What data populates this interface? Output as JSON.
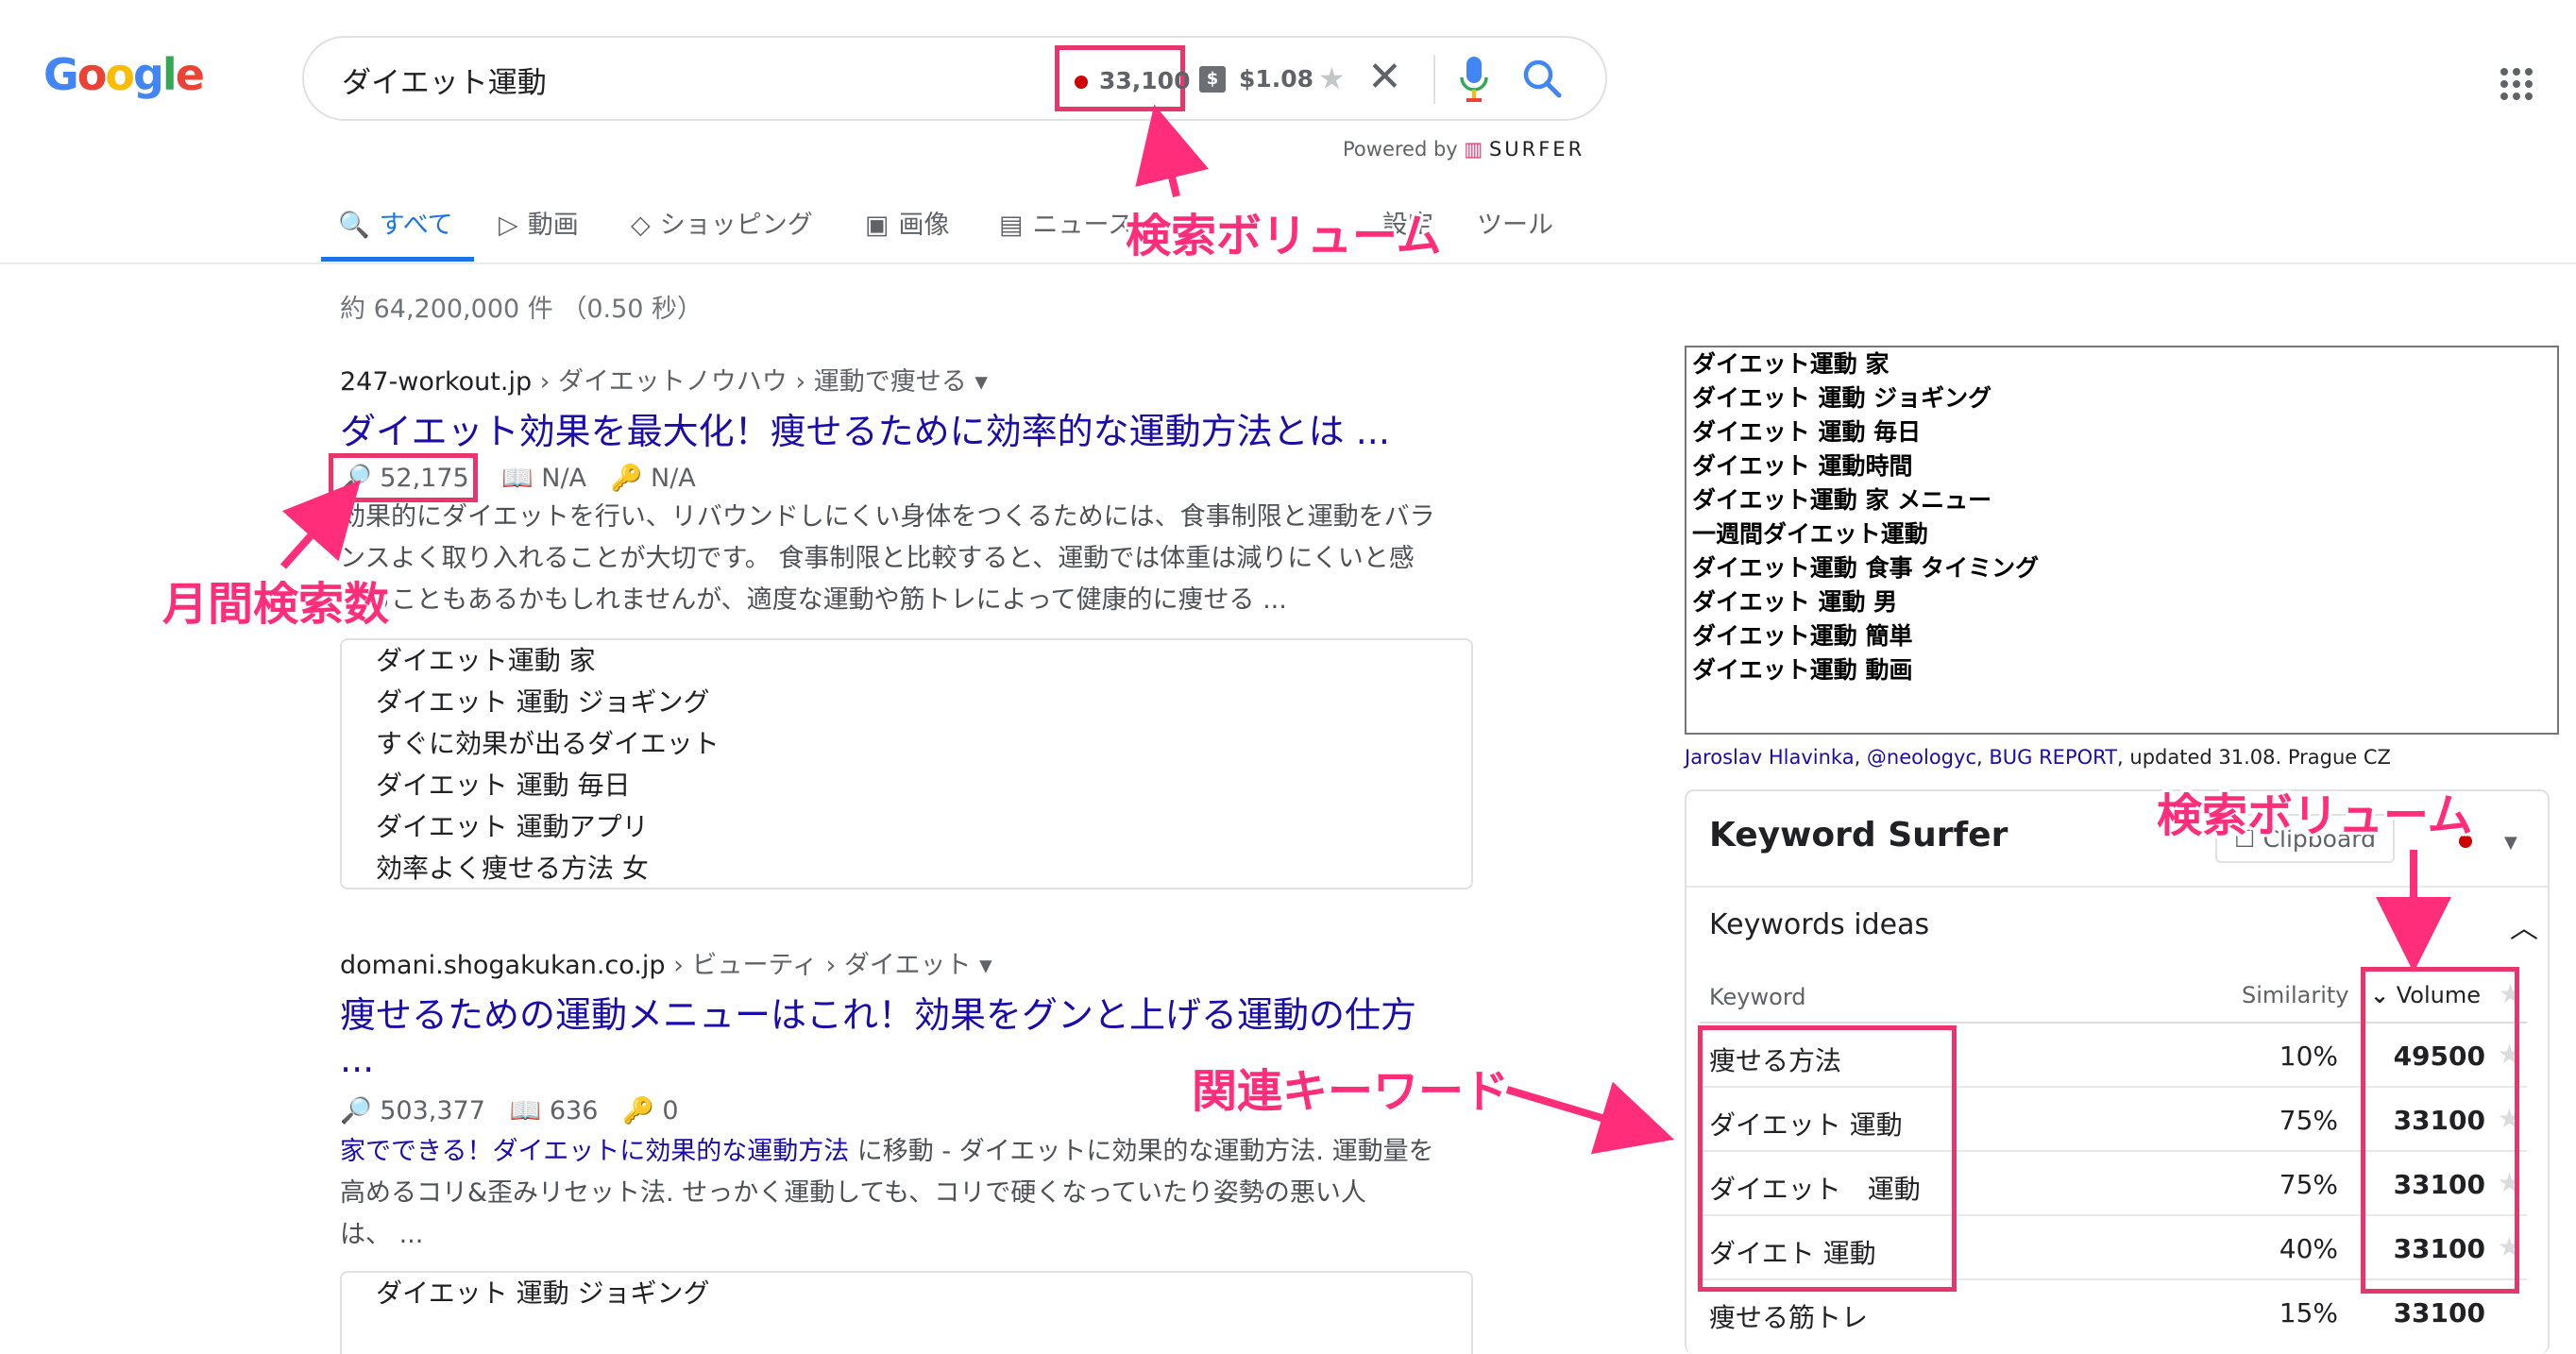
{
  "header": {
    "logo_letters": [
      "G",
      "o",
      "o",
      "g",
      "l",
      "e"
    ],
    "query": "ダイエット運動",
    "volume": "33,100",
    "cpc_symbol": "$",
    "cpc": "$1.08",
    "powered_prefix": "Powered by",
    "powered_brand": "SURFER"
  },
  "tabs": [
    {
      "label": "すべて",
      "icon": "search-icon"
    },
    {
      "label": "動画",
      "icon": "video-icon"
    },
    {
      "label": "ショッピング",
      "icon": "tag-icon"
    },
    {
      "label": "画像",
      "icon": "image-icon"
    },
    {
      "label": "ニュース",
      "icon": "news-icon"
    },
    {
      "label": "設定",
      "icon": ""
    },
    {
      "label": "ツール",
      "icon": ""
    }
  ],
  "stats": "約 64,200,000 件 （0.50 秒）",
  "results": [
    {
      "site": "247-workout.jp",
      "path": " › ダイエットノウハウ › 運動で痩せる",
      "title": "ダイエット効果を最大化！痩せるために効率的な運動方法とは ...",
      "search_volume": "52,175",
      "book_value": "N/A",
      "key_value": "N/A",
      "snippet_lines": [
        "効果的にダイエットを行い、リバウンドしにくい身体をつくるためには、食事制限と運動をバラ",
        "ンスよく取り入れることが大切です。 食事制限と比較すると、運動では体重は減りにくいと感",
        "じることもあるかもしれませんが、適度な運動や筋トレによって健康的に痩せる ..."
      ],
      "keywords": [
        "ダイエット運動 家",
        "ダイエット 運動 ジョギング",
        "すぐに効果が出るダイエット",
        "ダイエット 運動 毎日",
        "ダイエット 運動アプリ",
        "効率よく痩せる方法 女"
      ]
    },
    {
      "site": "domani.shogakukan.co.jp",
      "path": " › ビューティ › ダイエット",
      "title_lines": [
        "痩せるための運動メニューはこれ！効果をグンと上げる運動の仕方",
        "..."
      ],
      "search_volume": "503,377",
      "book_value": "636",
      "key_value": "0",
      "sitelink_text": "家でできる！ダイエットに効果的な運動方法",
      "sitelink_suffix": " に移動 - ",
      "snippet_lines": [
        "ダイエットに効果的な運動方法. 運動量を",
        "高めるコリ&歪みリセット法. せっかく運動しても、コリで硬くなっていたり姿勢の悪い人",
        "は、 ..."
      ],
      "keywords": [
        "ダイエット 運動 ジョギング"
      ]
    }
  ],
  "sidebar_keywords": [
    "ダイエット運動 家",
    "ダイエット 運動 ジョギング",
    "ダイエット 運動 毎日",
    "ダイエット 運動時間",
    "ダイエット運動 家 メニュー",
    "一週間ダイエット運動",
    "ダイエット運動 食事 タイミング",
    "ダイエット 運動 男",
    "ダイエット運動 簡単",
    "ダイエット運動 動画"
  ],
  "credits": {
    "author": "Jaroslav Hlavinka",
    "handle": "@neologyc",
    "bug": "BUG REPORT",
    "rest": ", updated 31.08. Prague CZ"
  },
  "surfer": {
    "title": "Keyword Surfer",
    "clipboard": "Clipboard",
    "section": "Keywords ideas",
    "col_keyword": "Keyword",
    "col_similarity": "Similarity",
    "col_volume": "Volume",
    "rows": [
      {
        "keyword": "痩せる方法",
        "similarity": "10%",
        "volume": "49500"
      },
      {
        "keyword": "ダイエット 運動",
        "similarity": "75%",
        "volume": "33100"
      },
      {
        "keyword": "ダイエット　運動",
        "similarity": "75%",
        "volume": "33100"
      },
      {
        "keyword": "ダイエト 運動",
        "similarity": "40%",
        "volume": "33100"
      },
      {
        "keyword": "痩せる筋トレ",
        "similarity": "15%",
        "volume": "33100"
      }
    ]
  },
  "annotations": {
    "volume_top": "検索ボリューム",
    "monthly": "月間検索数",
    "volume_side": "検索ボリューム",
    "related": "関連キーワード",
    "color": "#ff2d7a"
  }
}
